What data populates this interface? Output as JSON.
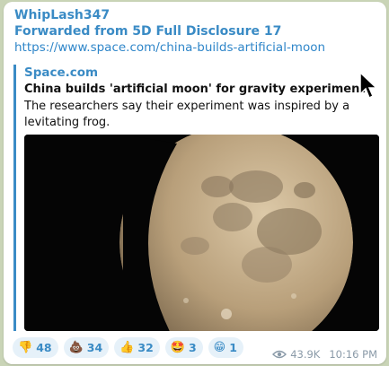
{
  "message": {
    "author": "WhipLash347",
    "forwarded_from": "Forwarded from 5D Full Disclosure 17",
    "link": "https://www.space.com/china-builds-artificial-moon"
  },
  "preview": {
    "site": "Space.com",
    "title": "China builds 'artificial moon' for gravity experiment",
    "description": "The researchers say their experiment was inspired by a levitating frog.",
    "image_icon": "moon-photo"
  },
  "reactions": [
    {
      "emoji": "👎",
      "count": "48",
      "icon": "thumbs-down-icon"
    },
    {
      "emoji": "💩",
      "count": "34",
      "icon": "poop-icon"
    },
    {
      "emoji": "👍",
      "count": "32",
      "icon": "thumbs-up-icon"
    },
    {
      "emoji": "🤩",
      "count": "3",
      "icon": "star-struck-icon"
    },
    {
      "emoji": "😁",
      "count": "1",
      "icon": "grin-icon"
    }
  ],
  "meta": {
    "views": "43.9K",
    "time": "10:16 PM",
    "views_icon": "eye-icon"
  },
  "colors": {
    "accent": "#3a8bc5",
    "background": "#c9d4b6",
    "reaction_bg": "#e6f1f9"
  }
}
